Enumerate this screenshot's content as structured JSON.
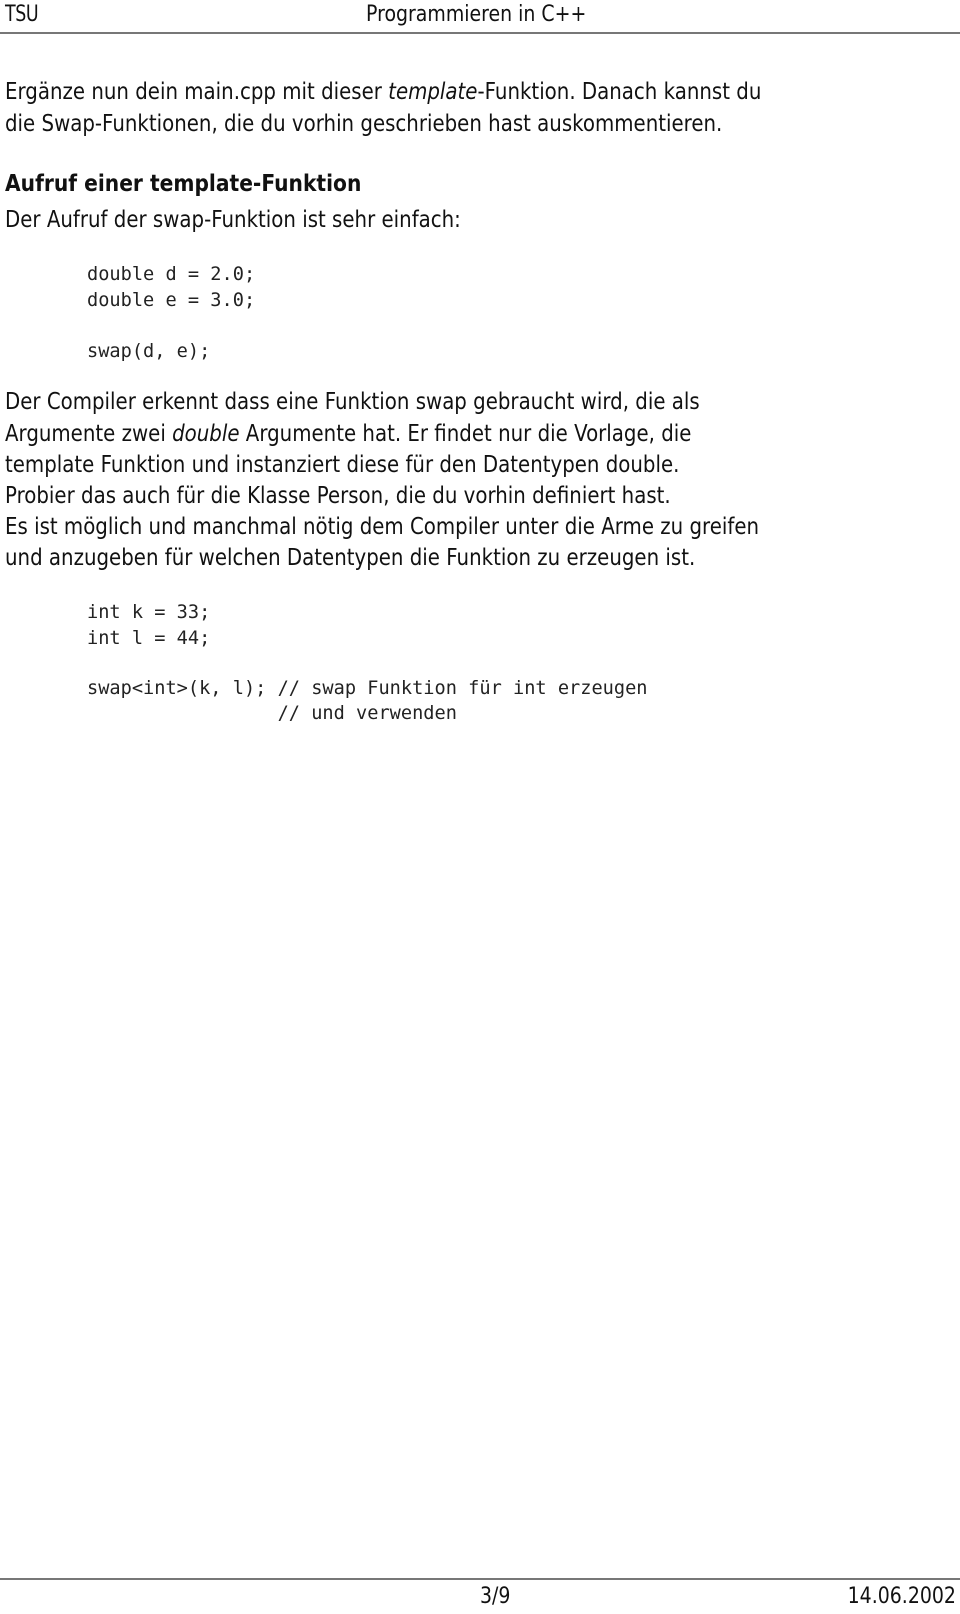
{
  "header": {
    "left": "TSU",
    "center": "Programmieren in C++"
  },
  "intro": {
    "line1_before": "Ergänze nun dein main.cpp mit dieser ",
    "line1_italic": "template",
    "line1_after": "-Funktion. Danach kannst du",
    "line2": "die Swap-Funktionen, die du vorhin geschrieben hast auskommentieren."
  },
  "section": {
    "heading": "Aufruf einer template-Funktion",
    "lead": "Der Aufruf der swap-Funktion ist sehr einfach:"
  },
  "code1": {
    "lines": [
      "double d = 2.0;",
      "double e = 3.0;",
      "",
      "swap(d, e);"
    ]
  },
  "explanation": {
    "line1": "Der Compiler erkennt dass eine Funktion swap gebraucht wird, die als",
    "line2_before": "Argumente zwei ",
    "line2_italic": "double",
    "line2_after": " Argumente hat. Er findet nur die Vorlage, die",
    "line3": "template Funktion und instanziert diese für den Datentypen double.",
    "line4": "Probier das auch für die Klasse Person, die du vorhin definiert hast.",
    "line5": "Es ist möglich und manchmal nötig dem Compiler unter die Arme zu greifen",
    "line6": "und anzugeben für welchen Datentypen die Funktion zu erzeugen ist."
  },
  "code2": {
    "lines": [
      "int k = 33;",
      "int l = 44;",
      "",
      "swap<int>(k, l); // swap Funktion für int erzeugen",
      "                 // und verwenden"
    ]
  },
  "footer": {
    "page": "3/9",
    "date": "14.06.2002"
  }
}
